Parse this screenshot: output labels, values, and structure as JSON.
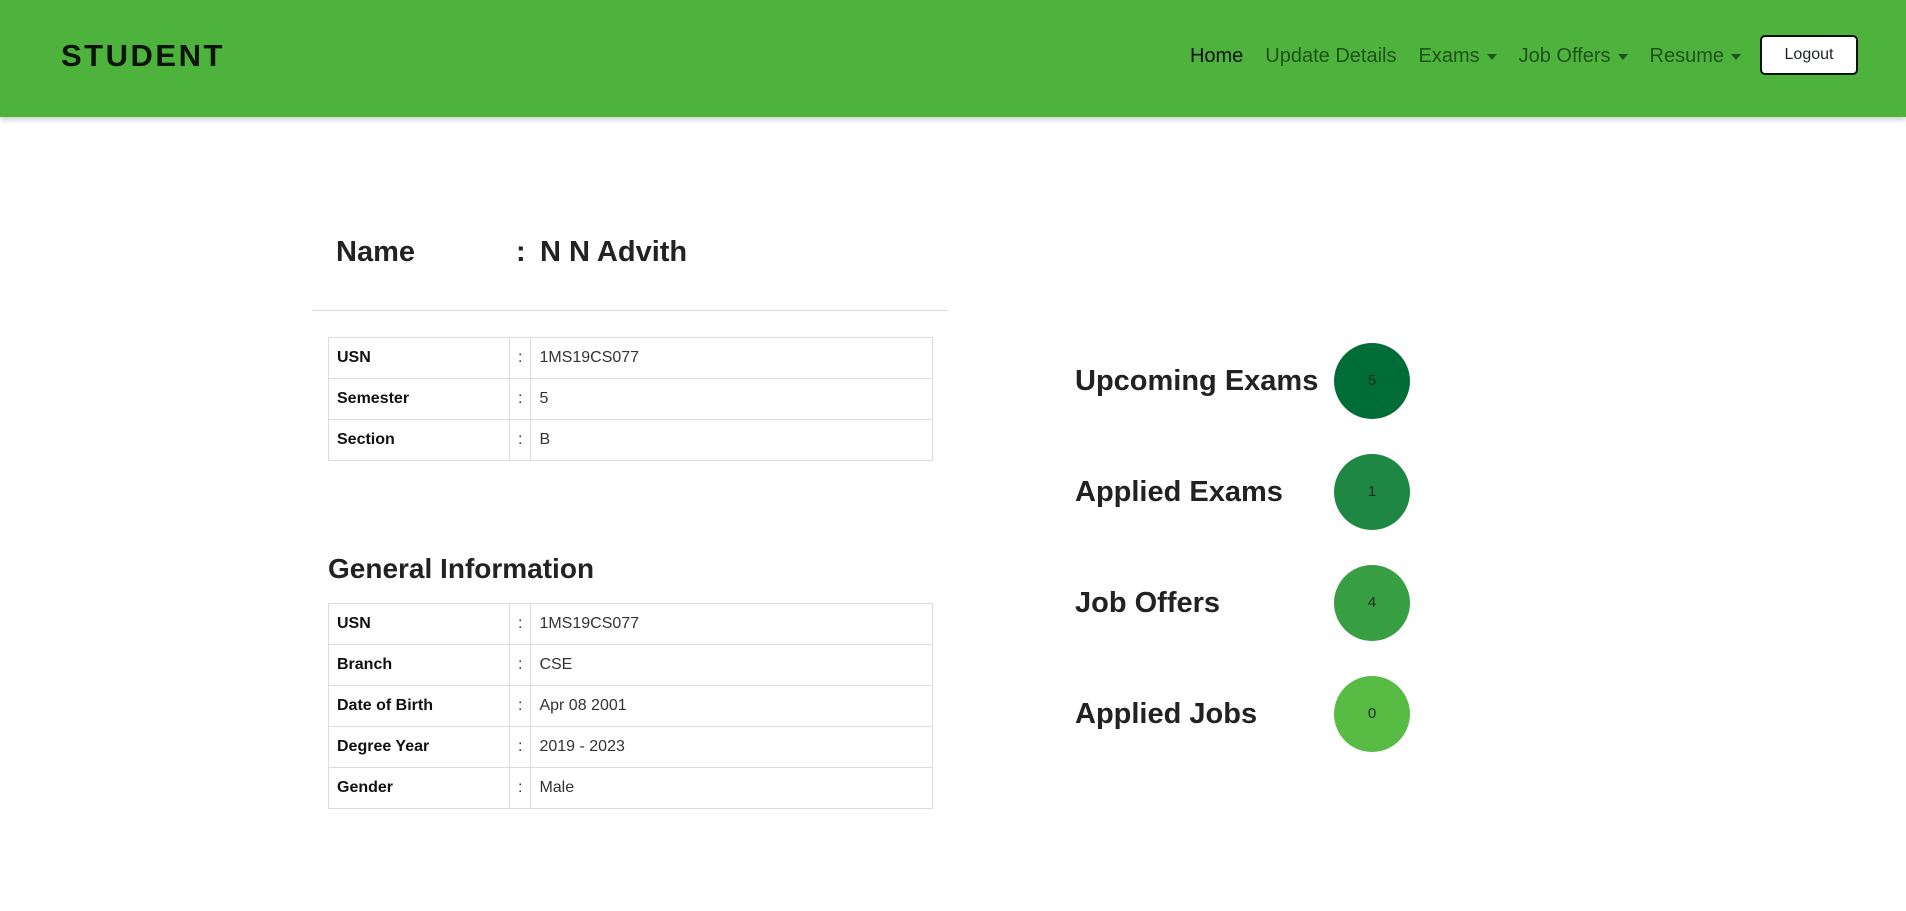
{
  "navbar": {
    "brand": "STUDENT",
    "links": {
      "home": "Home",
      "update_details": "Update Details",
      "exams": "Exams",
      "job_offers": "Job Offers",
      "resume": "Resume"
    },
    "logout_label": "Logout",
    "color": "#4db33d"
  },
  "profile": {
    "name_label": "Name",
    "separator": ":",
    "name_value": "N N Advith",
    "academic": [
      {
        "label": "USN",
        "value": "1MS19CS077"
      },
      {
        "label": "Semester",
        "value": "5"
      },
      {
        "label": "Section",
        "value": "B"
      }
    ]
  },
  "general": {
    "heading": "General Information",
    "rows": [
      {
        "label": "USN",
        "value": "1MS19CS077"
      },
      {
        "label": "Branch",
        "value": "CSE"
      },
      {
        "label": "Date of Birth",
        "value": "Apr 08 2001"
      },
      {
        "label": "Degree Year",
        "value": "2019 - 2023"
      },
      {
        "label": "Gender",
        "value": "Male"
      }
    ]
  },
  "stats": [
    {
      "label": "Upcoming Exams",
      "value": "5",
      "color": "#006d38"
    },
    {
      "label": "Applied Exams",
      "value": "1",
      "color": "#1e8743"
    },
    {
      "label": "Job Offers",
      "value": "4",
      "color": "#389e43"
    },
    {
      "label": "Applied Jobs",
      "value": "0",
      "color": "#58bb43"
    }
  ]
}
